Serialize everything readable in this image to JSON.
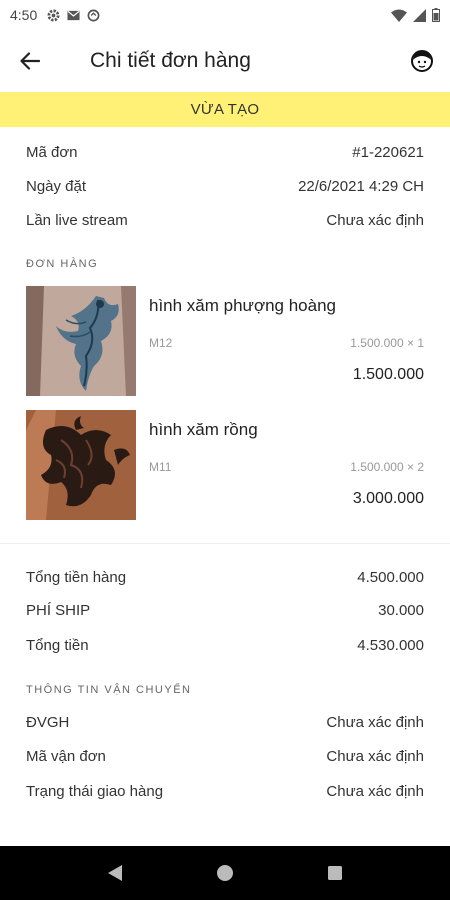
{
  "status_bar": {
    "time": "4:50"
  },
  "header": {
    "title": "Chi tiết đơn hàng"
  },
  "status_banner": "VỪA TẠO",
  "order_info": [
    {
      "label": "Mã đơn",
      "value": "#1-220621"
    },
    {
      "label": "Ngày đặt",
      "value": "22/6/2021 4:29 CH"
    },
    {
      "label": "Lần live stream",
      "value": "Chưa xác định"
    }
  ],
  "items_section_title": "ĐƠN HÀNG",
  "items": [
    {
      "name": "hình xăm phượng hoàng",
      "code": "M12",
      "unit_price": "1.500.000 × 1",
      "total": "1.500.000",
      "image_icon": "phoenix-tattoo-image"
    },
    {
      "name": "hình xăm rồng",
      "code": "M11",
      "unit_price": "1.500.000 × 2",
      "total": "3.000.000",
      "image_icon": "dragon-tattoo-image"
    }
  ],
  "summary": [
    {
      "label": "Tổng tiền hàng",
      "value": "4.500.000"
    },
    {
      "label": "PHÍ SHIP",
      "value": "30.000"
    },
    {
      "label": "Tổng tiền",
      "value": "4.530.000"
    }
  ],
  "shipping_section_title": "THÔNG TIN VẬN CHUYỂN",
  "shipping": [
    {
      "label": "ĐVGH",
      "value": "Chưa xác định"
    },
    {
      "label": "Mã vận đơn",
      "value": "Chưa xác định"
    },
    {
      "label": "Trạng thái giao hàng",
      "value": "Chưa xác định"
    }
  ],
  "colors": {
    "banner": "#fff176",
    "nav_bar": "#000000"
  }
}
